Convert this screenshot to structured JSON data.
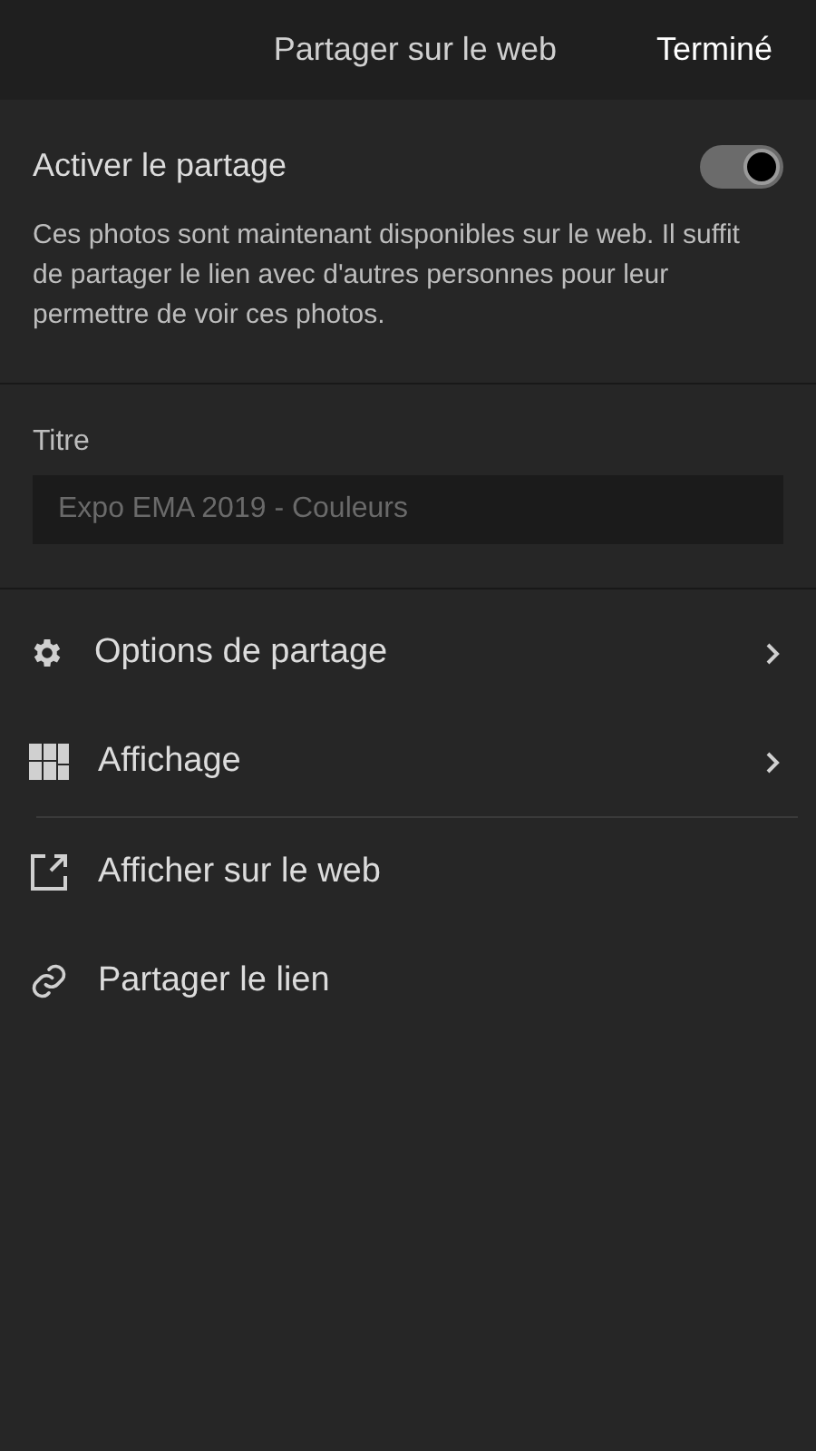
{
  "header": {
    "title": "Partager sur le web",
    "done_button": "Terminé"
  },
  "sharing": {
    "label": "Activer le partage",
    "on": true,
    "description": "Ces photos sont maintenant disponibles sur le web. Il suffit de partager le lien avec d'autres personnes pour leur permettre de voir ces photos."
  },
  "title_field": {
    "label": "Titre",
    "placeholder": "Expo EMA 2019 - Couleurs"
  },
  "menu_items": [
    {
      "label": "Options de partage",
      "kind": "submenu"
    },
    {
      "label": "Affichage",
      "kind": "submenu"
    },
    {
      "label": "Afficher sur le web",
      "kind": "action"
    },
    {
      "label": "Partager le lien",
      "kind": "action"
    }
  ]
}
